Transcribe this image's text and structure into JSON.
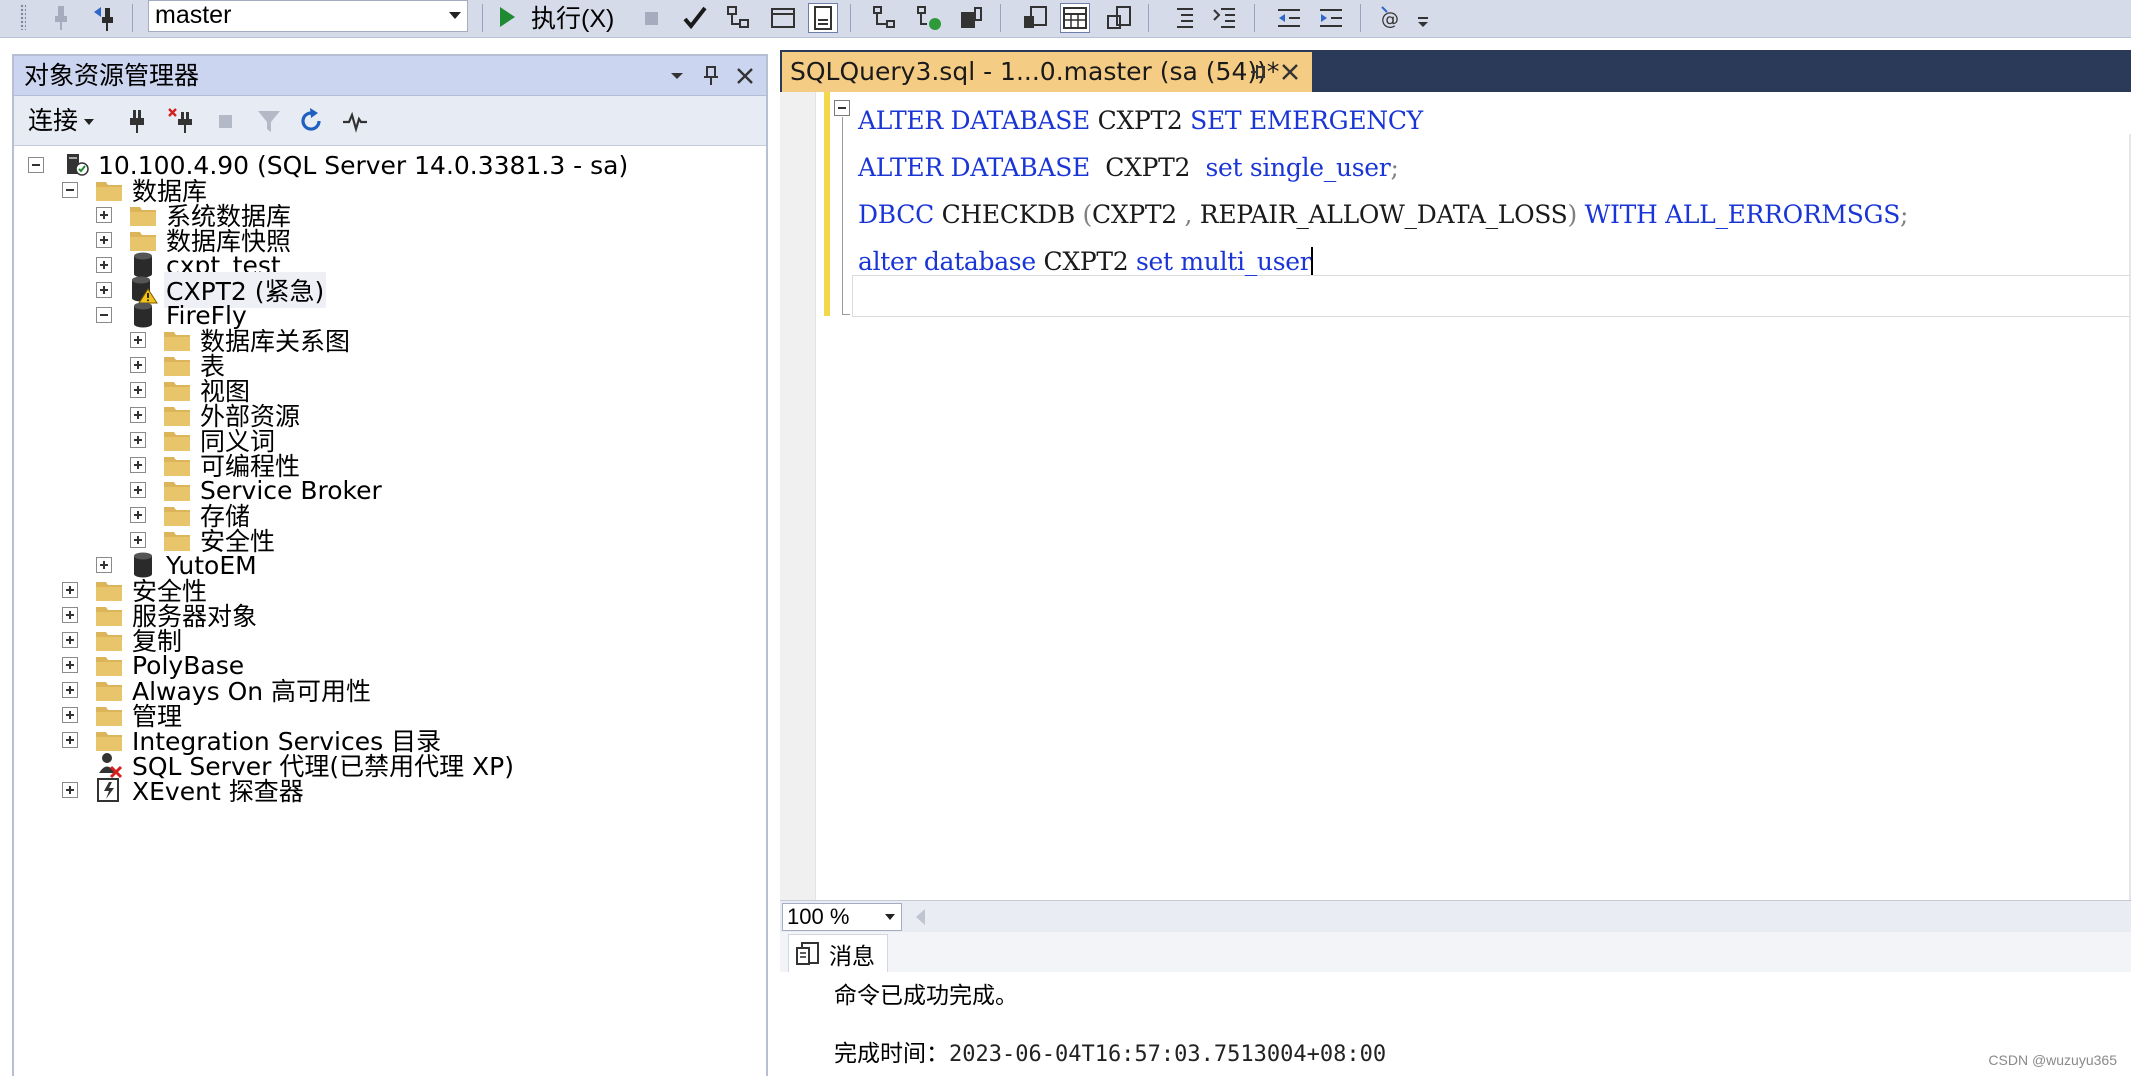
{
  "toolbar": {
    "database": "master",
    "execute_label": "执行(X)"
  },
  "object_explorer": {
    "title": "对象资源管理器",
    "connect_label": "连接",
    "tree": [
      {
        "label": "10.100.4.90 (SQL Server 14.0.3381.3 - sa)",
        "icon": "server-icon",
        "expander": "minus"
      },
      {
        "label": "数据库",
        "icon": "folder-icon",
        "expander": "minus"
      },
      {
        "label": "系统数据库",
        "icon": "folder-icon",
        "expander": "plus"
      },
      {
        "label": "数据库快照",
        "icon": "folder-icon",
        "expander": "plus"
      },
      {
        "label": "cxpt_test",
        "icon": "database-icon",
        "expander": "plus"
      },
      {
        "label": "CXPT2 (紧急)",
        "icon": "database-warning-icon",
        "expander": "plus"
      },
      {
        "label": "FireFly",
        "icon": "database-icon",
        "expander": "minus"
      },
      {
        "label": "数据库关系图",
        "icon": "folder-icon",
        "expander": "plus"
      },
      {
        "label": "表",
        "icon": "folder-icon",
        "expander": "plus"
      },
      {
        "label": "视图",
        "icon": "folder-icon",
        "expander": "plus"
      },
      {
        "label": "外部资源",
        "icon": "folder-icon",
        "expander": "plus"
      },
      {
        "label": "同义词",
        "icon": "folder-icon",
        "expander": "plus"
      },
      {
        "label": "可编程性",
        "icon": "folder-icon",
        "expander": "plus"
      },
      {
        "label": "Service Broker",
        "icon": "folder-icon",
        "expander": "plus"
      },
      {
        "label": "存储",
        "icon": "folder-icon",
        "expander": "plus"
      },
      {
        "label": "安全性",
        "icon": "folder-icon",
        "expander": "plus"
      },
      {
        "label": "YutoEM",
        "icon": "database-icon",
        "expander": "plus"
      },
      {
        "label": "安全性",
        "icon": "folder-icon",
        "expander": "plus"
      },
      {
        "label": "服务器对象",
        "icon": "folder-icon",
        "expander": "plus"
      },
      {
        "label": "复制",
        "icon": "folder-icon",
        "expander": "plus"
      },
      {
        "label": "PolyBase",
        "icon": "folder-icon",
        "expander": "plus"
      },
      {
        "label": "Always On 高可用性",
        "icon": "folder-icon",
        "expander": "plus"
      },
      {
        "label": "管理",
        "icon": "folder-icon",
        "expander": "plus"
      },
      {
        "label": "Integration Services 目录",
        "icon": "folder-icon",
        "expander": "plus"
      },
      {
        "label": "SQL Server 代理(已禁用代理 XP)",
        "icon": "sql-agent-icon",
        "expander": "none"
      },
      {
        "label": "XEvent 探查器",
        "icon": "xevent-icon",
        "expander": "plus"
      }
    ]
  },
  "editor": {
    "tab_title": "SQLQuery3.sql - 1...0.master (sa (54))*",
    "lines": [
      [
        {
          "t": "ALTER DATABASE",
          "c": "kw"
        },
        {
          "t": " CXPT2 ",
          "c": "id"
        },
        {
          "t": "SET EMERGENCY",
          "c": "kw"
        }
      ],
      [
        {
          "t": "ALTER DATABASE",
          "c": "kw"
        },
        {
          "t": "  CXPT2  ",
          "c": "id"
        },
        {
          "t": "set single_user",
          "c": "kw"
        },
        {
          "t": ";",
          "c": "gr"
        }
      ],
      [
        {
          "t": "DBCC",
          "c": "kw"
        },
        {
          "t": " CHECKDB ",
          "c": "id"
        },
        {
          "t": "(",
          "c": "gr"
        },
        {
          "t": "CXPT2 ",
          "c": "id"
        },
        {
          "t": ",",
          "c": "gr"
        },
        {
          "t": " REPAIR_ALLOW_DATA_LOSS",
          "c": "id"
        },
        {
          "t": ")",
          "c": "gr"
        },
        {
          "t": " WITH ALL_ERRORMSGS",
          "c": "kw"
        },
        {
          "t": ";",
          "c": "gr"
        }
      ],
      [
        {
          "t": "alter database",
          "c": "kw"
        },
        {
          "t": " CXPT2 ",
          "c": "id"
        },
        {
          "t": "set multi_user",
          "c": "kw"
        }
      ]
    ],
    "zoom": "100 %"
  },
  "results": {
    "tab_label": "消息",
    "message": "命令已成功完成。",
    "completion_label": "完成时间：",
    "completion_time": "2023-06-04T16:57:03.7513004+08:00"
  },
  "watermark": "CSDN @wuzuyu365"
}
